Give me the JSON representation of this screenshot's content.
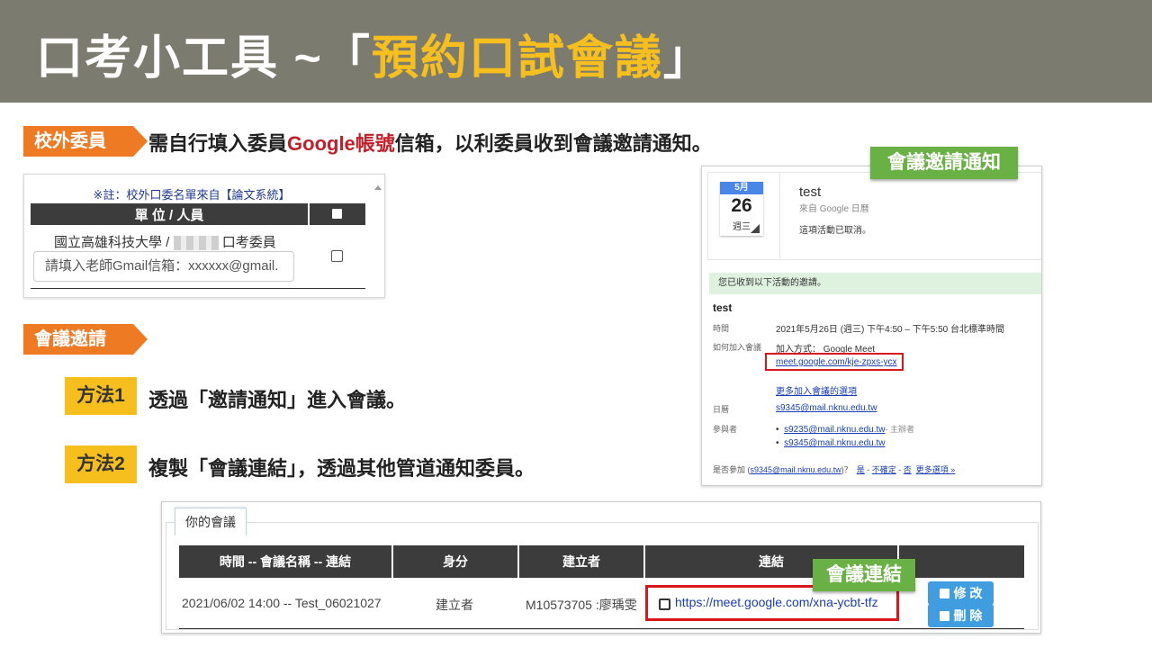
{
  "slide": {
    "title_prefix": "口考小工具 ~「",
    "title_highlight": "預約口試會議",
    "title_suffix": "」"
  },
  "section1": {
    "tag": "校外委員",
    "text_before": "需自行填入委員",
    "text_red": "Google帳號",
    "text_after": "信箱，以利委員收到會議邀請通知。"
  },
  "committee_panel": {
    "note": "※註：校外口委名單來自【論文系統】",
    "col_unit": "單 位 / 人員",
    "unit_prefix": "國立高雄科技大學 /",
    "unit_suffix": "口考委員",
    "email_placeholder": "請填入老師Gmail信箱：xxxxxx@gmail."
  },
  "section2": {
    "tag": "會議邀請"
  },
  "methods": [
    {
      "label": "方法1",
      "text": "透過「邀請通知」進入會議。"
    },
    {
      "label": "方法2",
      "text": "複製「會議連結」，透過其他管道通知委員。"
    }
  ],
  "labels": {
    "invite_notice": "會議邀請通知",
    "meeting_link": "會議連結"
  },
  "invite_email": {
    "cal_month": "5月",
    "cal_day": "26",
    "cal_weekday": "週三",
    "event_name": "test",
    "source": "來自 Google 日曆",
    "cancelled": "這項活動已取消。",
    "received": "您已收到以下活動的邀請。",
    "title": "test",
    "time_label": "時間",
    "time_value": "2021年5月26日 (週三) 下午4:50 – 下午5:50 台北標準時間",
    "join_label": "如何加入會議",
    "join_method": "加入方式： Google Meet",
    "join_link": "meet.google.com/kje-zpxs-ycx",
    "more_options": "更多加入會議的選項",
    "calendar_label": "日曆",
    "calendar_value": "s9345@mail.nknu.edu.tw",
    "attendees_label": "參與者",
    "attendee1": "s9235@mail.nknu.edu.tw",
    "attendee1_role": "- 主辦者",
    "attendee2": "s9345@mail.nknu.edu.tw",
    "rsvp_prefix": "是否參加 (",
    "rsvp_email": "s9345@mail.nknu.edu.tw",
    "rsvp_mid": ")？",
    "rsvp_yes": "是",
    "rsvp_maybe": "不確定",
    "rsvp_no": "否",
    "rsvp_more": "更多選項 »"
  },
  "meetings": {
    "tab": "你的會議",
    "headers": [
      "時間 -- 會議名稱 -- 連結",
      "身分",
      "建立者",
      "連結"
    ],
    "row": {
      "time_name": "2021/06/02 14:00 -- Test_06021027",
      "role": "建立者",
      "creator": "M10573705 :廖瑀雯",
      "url": "https://meet.google.com/xna-ycbt-tfz"
    },
    "edit": "修 改",
    "delete": "刪 除"
  },
  "colors": {
    "header_bg": "#7b7b70",
    "highlight": "#f6bf1d",
    "tag_orange": "#ee7a24",
    "label_green": "#69b144",
    "link_red_box": "#d9161b",
    "button_blue": "#3f9de0"
  }
}
